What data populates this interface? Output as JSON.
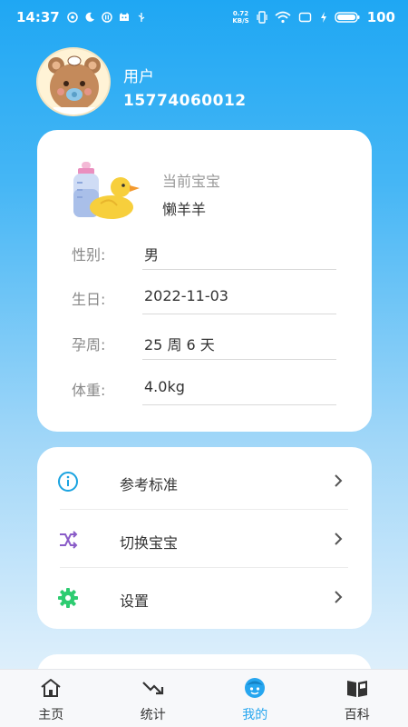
{
  "status_bar": {
    "time": "14:37",
    "net_speed_value": "0.72",
    "net_speed_unit": "KB/S",
    "battery": "100"
  },
  "profile": {
    "name": "用户",
    "phone": "15774060012"
  },
  "baby": {
    "current_label": "当前宝宝",
    "name": "懒羊羊",
    "fields": [
      {
        "label": "性别:",
        "value": "男"
      },
      {
        "label": "生日:",
        "value": "2022-11-03"
      },
      {
        "label": "孕周:",
        "value": "25 周 6 天"
      },
      {
        "label": "体重:",
        "value": "4.0kg"
      }
    ]
  },
  "menu": {
    "items": [
      {
        "label": "参考标准",
        "icon": "info-icon",
        "color": "#1aa3e0"
      },
      {
        "label": "切换宝宝",
        "icon": "shuffle-icon",
        "color": "#8a5cc8"
      },
      {
        "label": "设置",
        "icon": "gear-icon",
        "color": "#2ecc71"
      }
    ]
  },
  "tabs": [
    {
      "label": "主页",
      "icon": "home-icon",
      "active": false
    },
    {
      "label": "统计",
      "icon": "trend-down-icon",
      "active": false
    },
    {
      "label": "我的",
      "icon": "face-icon",
      "active": true
    },
    {
      "label": "百科",
      "icon": "book-icon",
      "active": false
    }
  ],
  "colors": {
    "accent": "#26a6ef",
    "header_gradient_top": "#1fa7f3",
    "card_bg": "#ffffff",
    "tab_bg": "#f7f8fa"
  }
}
